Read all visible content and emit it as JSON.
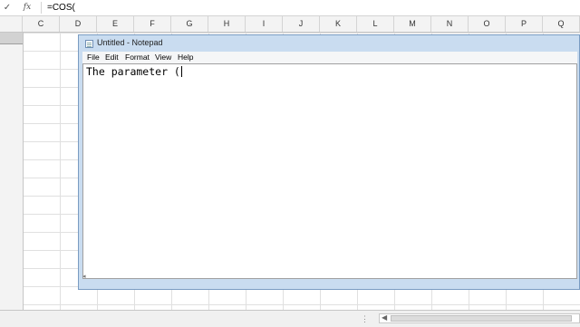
{
  "formula_bar": {
    "check_icon": "✓",
    "fx_label": "fx",
    "content": "=COS("
  },
  "columns": [
    "C",
    "D",
    "E",
    "F",
    "G",
    "H",
    "I",
    "J",
    "K",
    "L",
    "M",
    "N",
    "O",
    "P",
    "Q"
  ],
  "notepad": {
    "title": "Untitled - Notepad",
    "menu": [
      "File",
      "Edit",
      "Format",
      "View",
      "Help"
    ],
    "text": "The parameter ("
  },
  "colors": {
    "window_frame": "#c9dcf0",
    "grid_line": "#e0e0e0",
    "header_bg": "#f3f3f3"
  }
}
